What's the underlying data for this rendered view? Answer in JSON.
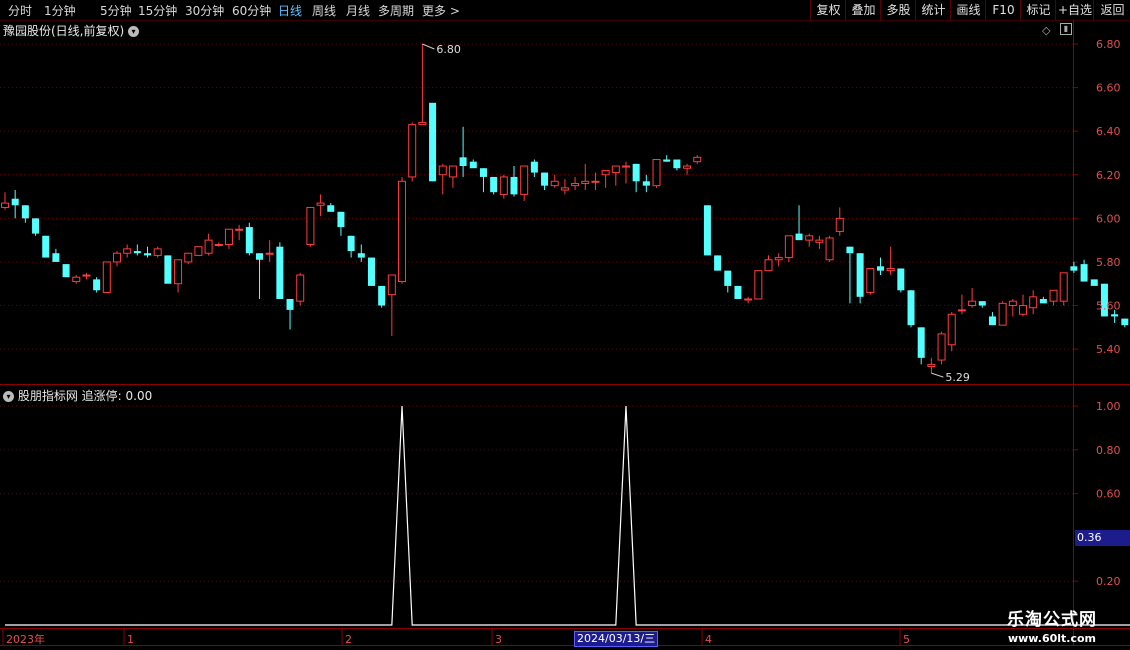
{
  "toolbar": {
    "timeframes": [
      "分时",
      "1分钟",
      "5分钟",
      "15分钟",
      "30分钟",
      "60分钟",
      "日线",
      "周线",
      "月线",
      "多周期",
      "更多 >"
    ],
    "active_timeframe": "日线",
    "buttons": [
      "复权",
      "叠加",
      "多股",
      "统计",
      "画线",
      "F10",
      "标记",
      "+自选",
      "返回"
    ]
  },
  "main_chart": {
    "title": "豫园股份(日线,前复权)",
    "high_label": "6.80",
    "low_label": "5.29",
    "y_ticks": [
      "6.80",
      "6.60",
      "6.40",
      "6.20",
      "6.00",
      "5.80",
      "5.60",
      "5.40"
    ],
    "colors": {
      "up": "#ff3c3c",
      "down": "#54ffff",
      "axis": "#8b0000"
    }
  },
  "indicator": {
    "name": "股朋指标网",
    "series_label": "追涨停:",
    "series_value": "0.00",
    "y_ticks": [
      "1.00",
      "0.80",
      "0.60",
      "0.20"
    ],
    "highlight_value": "0.36"
  },
  "x_axis": {
    "labels": [
      "2023年",
      "1",
      "2",
      "3",
      "4",
      "5"
    ],
    "highlight_date": "2024/03/13/三"
  },
  "watermark": {
    "line1": "乐淘公式网",
    "line2": "www.60lt.com"
  },
  "chart_data": {
    "type": "candlestick",
    "ohlc": [
      [
        6.05,
        6.12,
        6.04,
        6.07
      ],
      [
        6.09,
        6.13,
        6.0,
        6.06
      ],
      [
        6.06,
        6.06,
        5.98,
        6.0
      ],
      [
        6.0,
        6.0,
        5.92,
        5.93
      ],
      [
        5.92,
        5.92,
        5.85,
        5.82
      ],
      [
        5.84,
        5.86,
        5.8,
        5.8
      ],
      [
        5.79,
        5.79,
        5.75,
        5.73
      ],
      [
        5.71,
        5.74,
        5.7,
        5.73
      ],
      [
        5.74,
        5.75,
        5.72,
        5.74
      ],
      [
        5.72,
        5.73,
        5.66,
        5.67
      ],
      [
        5.66,
        5.8,
        5.66,
        5.8
      ],
      [
        5.8,
        5.85,
        5.78,
        5.84
      ],
      [
        5.84,
        5.88,
        5.82,
        5.86
      ],
      [
        5.85,
        5.88,
        5.83,
        5.84
      ],
      [
        5.84,
        5.87,
        5.82,
        5.83
      ],
      [
        5.83,
        5.87,
        5.82,
        5.86
      ],
      [
        5.83,
        5.83,
        5.72,
        5.7
      ],
      [
        5.7,
        5.81,
        5.66,
        5.81
      ],
      [
        5.8,
        5.84,
        5.79,
        5.84
      ],
      [
        5.83,
        5.87,
        5.83,
        5.87
      ],
      [
        5.84,
        5.93,
        5.83,
        5.9
      ],
      [
        5.88,
        5.89,
        5.87,
        5.88
      ],
      [
        5.88,
        5.95,
        5.86,
        5.95
      ],
      [
        5.95,
        5.97,
        5.9,
        5.95
      ],
      [
        5.96,
        5.98,
        5.83,
        5.84
      ],
      [
        5.84,
        5.84,
        5.63,
        5.81
      ],
      [
        5.84,
        5.9,
        5.8,
        5.84
      ],
      [
        5.87,
        5.89,
        5.64,
        5.63
      ],
      [
        5.63,
        5.63,
        5.49,
        5.58
      ],
      [
        5.62,
        5.75,
        5.6,
        5.74
      ],
      [
        5.88,
        6.05,
        5.87,
        6.05
      ],
      [
        6.06,
        6.11,
        6.01,
        6.07
      ],
      [
        6.06,
        6.07,
        6.03,
        6.03
      ],
      [
        6.03,
        6.03,
        5.92,
        5.96
      ],
      [
        5.92,
        5.92,
        5.82,
        5.85
      ],
      [
        5.84,
        5.88,
        5.8,
        5.82
      ],
      [
        5.82,
        5.82,
        5.7,
        5.69
      ],
      [
        5.69,
        5.69,
        5.59,
        5.6
      ],
      [
        5.65,
        5.69,
        5.46,
        5.74
      ],
      [
        5.71,
        6.19,
        5.7,
        6.17
      ],
      [
        6.19,
        6.44,
        6.17,
        6.43
      ],
      [
        6.43,
        6.8,
        6.43,
        6.44
      ],
      [
        6.53,
        6.53,
        6.17,
        6.17
      ],
      [
        6.2,
        6.25,
        6.11,
        6.24
      ],
      [
        6.19,
        6.22,
        6.14,
        6.24
      ],
      [
        6.28,
        6.42,
        6.19,
        6.24
      ],
      [
        6.26,
        6.27,
        6.26,
        6.23
      ],
      [
        6.23,
        6.23,
        6.12,
        6.19
      ],
      [
        6.19,
        6.19,
        6.11,
        6.12
      ],
      [
        6.11,
        6.2,
        6.09,
        6.19
      ],
      [
        6.19,
        6.24,
        6.1,
        6.11
      ],
      [
        6.11,
        6.24,
        6.08,
        6.24
      ],
      [
        6.26,
        6.27,
        6.19,
        6.21
      ],
      [
        6.21,
        6.21,
        6.13,
        6.15
      ],
      [
        6.15,
        6.2,
        6.14,
        6.17
      ],
      [
        6.13,
        6.18,
        6.11,
        6.14
      ],
      [
        6.15,
        6.19,
        6.13,
        6.16
      ],
      [
        6.16,
        6.25,
        6.13,
        6.17
      ],
      [
        6.17,
        6.21,
        6.13,
        6.17
      ],
      [
        6.2,
        6.22,
        6.14,
        6.22
      ],
      [
        6.21,
        6.23,
        6.15,
        6.24
      ],
      [
        6.24,
        6.26,
        6.16,
        6.24
      ],
      [
        6.25,
        6.25,
        6.12,
        6.17
      ],
      [
        6.17,
        6.2,
        6.12,
        6.15
      ],
      [
        6.15,
        6.27,
        6.14,
        6.27
      ],
      [
        6.27,
        6.29,
        6.26,
        6.26
      ],
      [
        6.27,
        6.27,
        6.22,
        6.23
      ],
      [
        6.23,
        6.25,
        6.2,
        6.24
      ],
      [
        6.26,
        6.29,
        6.25,
        6.28
      ],
      [
        6.06,
        6.06,
        5.83,
        5.83
      ],
      [
        5.83,
        5.83,
        5.76,
        5.76
      ],
      [
        5.76,
        5.76,
        5.66,
        5.69
      ],
      [
        5.69,
        5.69,
        5.63,
        5.63
      ],
      [
        5.63,
        5.64,
        5.61,
        5.63
      ],
      [
        5.63,
        5.76,
        5.63,
        5.76
      ],
      [
        5.76,
        5.83,
        5.76,
        5.81
      ],
      [
        5.81,
        5.84,
        5.78,
        5.82
      ],
      [
        5.82,
        5.92,
        5.8,
        5.92
      ],
      [
        5.93,
        6.06,
        5.91,
        5.9
      ],
      [
        5.9,
        5.93,
        5.87,
        5.92
      ],
      [
        5.89,
        5.92,
        5.86,
        5.9
      ],
      [
        5.81,
        5.92,
        5.8,
        5.91
      ],
      [
        5.94,
        6.05,
        5.92,
        6.0
      ],
      [
        5.87,
        5.87,
        5.61,
        5.84
      ],
      [
        5.84,
        5.84,
        5.61,
        5.64
      ],
      [
        5.66,
        5.77,
        5.65,
        5.77
      ],
      [
        5.78,
        5.82,
        5.74,
        5.76
      ],
      [
        5.76,
        5.87,
        5.74,
        5.77
      ],
      [
        5.77,
        5.77,
        5.66,
        5.67
      ],
      [
        5.67,
        5.67,
        5.5,
        5.51
      ],
      [
        5.5,
        5.5,
        5.33,
        5.36
      ],
      [
        5.32,
        5.36,
        5.29,
        5.33
      ],
      [
        5.35,
        5.48,
        5.33,
        5.47
      ],
      [
        5.42,
        5.57,
        5.39,
        5.56
      ],
      [
        5.58,
        5.65,
        5.56,
        5.58
      ],
      [
        5.6,
        5.68,
        5.59,
        5.62
      ],
      [
        5.62,
        5.62,
        5.59,
        5.6
      ],
      [
        5.55,
        5.57,
        5.51,
        5.51
      ],
      [
        5.51,
        5.62,
        5.51,
        5.61
      ],
      [
        5.6,
        5.63,
        5.55,
        5.62
      ],
      [
        5.56,
        5.65,
        5.55,
        5.6
      ],
      [
        5.59,
        5.67,
        5.56,
        5.64
      ],
      [
        5.63,
        5.64,
        5.62,
        5.61
      ],
      [
        5.62,
        5.66,
        5.6,
        5.67
      ],
      [
        5.62,
        5.75,
        5.6,
        5.75
      ],
      [
        5.78,
        5.8,
        5.75,
        5.76
      ],
      [
        5.79,
        5.81,
        5.71,
        5.71
      ],
      [
        5.72,
        5.72,
        5.71,
        5.69
      ],
      [
        5.7,
        5.7,
        5.56,
        5.55
      ],
      [
        5.56,
        5.58,
        5.52,
        5.55
      ],
      [
        5.54,
        5.54,
        5.5,
        5.51
      ],
      [
        5.52,
        5.52,
        5.41,
        5.42
      ],
      [
        5.43,
        5.48,
        5.42,
        5.44
      ]
    ],
    "up_color": "#ff3c3c",
    "down_color": "#54ffff",
    "ylim": [
      5.24,
      6.91
    ],
    "indicator": {
      "name": "追涨停",
      "spikes_at_bar": [
        39,
        61
      ],
      "spike_value": 1.0,
      "baseline": 0.0,
      "ylim": [
        0.0,
        1.0
      ]
    }
  }
}
